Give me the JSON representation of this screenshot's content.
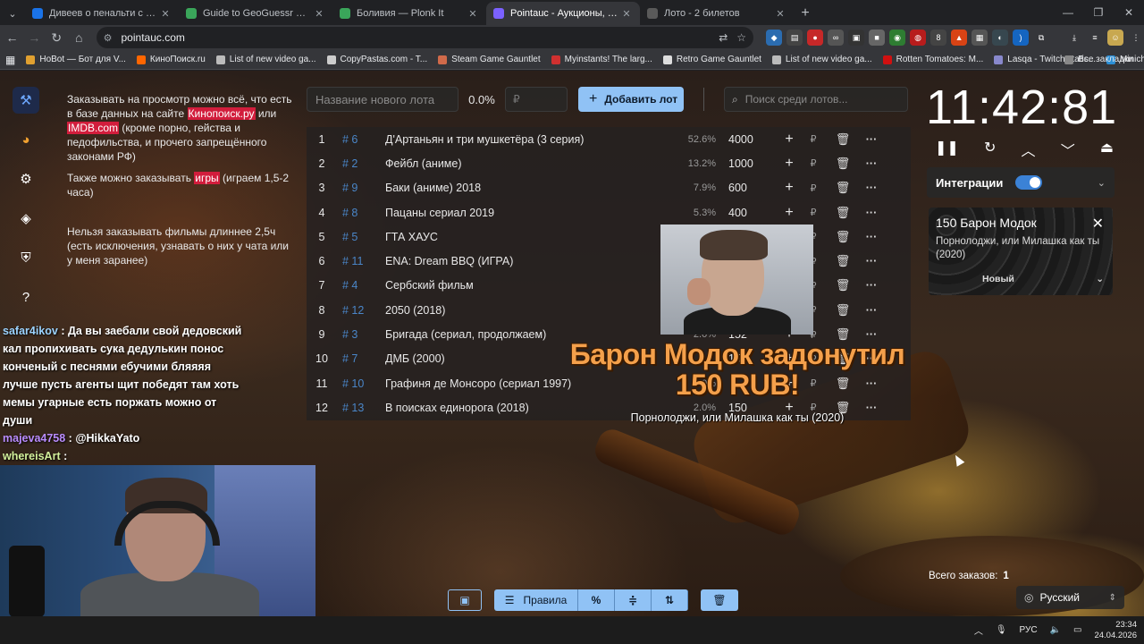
{
  "browser": {
    "tabs": [
      {
        "title": "Дивеев о пенальти с «Локо»:",
        "color": "#1a73e8",
        "active": false
      },
      {
        "title": "Guide to GeoGuessr — Plonk It",
        "color": "#3aa55a",
        "active": false
      },
      {
        "title": "Боливия — Plonk It",
        "color": "#3aa55a",
        "active": false
      },
      {
        "title": "Pointauc - Аукционы, лотереи",
        "color": "#7b61ff",
        "active": true
      },
      {
        "title": "Лото - 2 билетов",
        "color": "#5a5a5a",
        "active": false
      }
    ],
    "url": "pointauc.com",
    "bookmarks": [
      {
        "label": "HoBot — Бот для V...",
        "color": "#e0a030"
      },
      {
        "label": "КиноПоиск.ru",
        "color": "#ff6600"
      },
      {
        "label": "List of new video ga...",
        "color": "#bbbbbb"
      },
      {
        "label": "CopyPastas.com - T...",
        "color": "#cccccc"
      },
      {
        "label": "Steam Game Gauntlet",
        "color": "#d06a4a"
      },
      {
        "label": "Myinstants! The larg...",
        "color": "#d03030"
      },
      {
        "label": "Retro Game Gauntlet",
        "color": "#dddddd"
      },
      {
        "label": "List of new video ga...",
        "color": "#bbbbbb"
      },
      {
        "label": "Rotten Tomatoes: M...",
        "color": "#d01010"
      },
      {
        "label": "Lasqa - Twitch statis...",
        "color": "#8888cc"
      },
      {
        "label": "Minichat - The Fast...",
        "color": "#2b8fd6"
      }
    ],
    "all_bookmarks": "Все закладки"
  },
  "rules": {
    "p1_prefix": "Заказывать на просмотр можно всё, что есть в базе данных на сайте ",
    "p1_link1": "Кинопоиск.ру",
    "p1_mid": " или ",
    "p1_link2": "IMDB.com",
    "p1_suffix": " (кроме порно, гейства и педофильства, и прочего запрещённого законами РФ)",
    "p2_prefix": "Также можно заказывать ",
    "p2_link": "игры",
    "p2_suffix": " (играем 1,5-2 часа)",
    "p3": "Нельзя заказывать фильмы длиннее 2,5ч (есть исключения, узнавать о них у чата или у меня заранее)"
  },
  "lot_form": {
    "name_placeholder": "Название нового лота",
    "percent": "0.0%",
    "rub_placeholder": "₽",
    "add_label": "Добавить лот",
    "search_placeholder": "Поиск среди лотов..."
  },
  "lots": [
    {
      "n": "1",
      "id": "# 6",
      "name": "Д'Артаньян и три мушкетёра (3 серия)",
      "pct": "52.6%",
      "amount": "4000"
    },
    {
      "n": "2",
      "id": "# 2",
      "name": "Фейбл (аниме)",
      "pct": "13.2%",
      "amount": "1000"
    },
    {
      "n": "3",
      "id": "# 9",
      "name": "Баки (аниме) 2018",
      "pct": "7.9%",
      "amount": "600"
    },
    {
      "n": "4",
      "id": "# 8",
      "name": "Пацаны сериал 2019",
      "pct": "5.3%",
      "amount": "400"
    },
    {
      "n": "5",
      "id": "# 5",
      "name": "ГТА ХАУС",
      "pct": "",
      "amount": ""
    },
    {
      "n": "6",
      "id": "# 11",
      "name": "ENA: Dream BBQ (ИГРА)",
      "pct": "",
      "amount": ""
    },
    {
      "n": "7",
      "id": "# 4",
      "name": "Сербский фильм",
      "pct": "",
      "amount": ""
    },
    {
      "n": "8",
      "id": "# 12",
      "name": "2050 (2018)",
      "pct": "",
      "amount": ""
    },
    {
      "n": "9",
      "id": "# 3",
      "name": "Бригада (сериал, продолжаем)",
      "pct": "2.0%",
      "amount": "152"
    },
    {
      "n": "10",
      "id": "# 7",
      "name": "ДМБ (2000)",
      "pct": "",
      "amount": "150"
    },
    {
      "n": "11",
      "id": "# 10",
      "name": "Графиня де Монсоро (сериал 1997)",
      "pct": "2.0%",
      "amount": ""
    },
    {
      "n": "12",
      "id": "# 13",
      "name": "В поисках единорога (2018)",
      "pct": "2.0%",
      "amount": "150"
    }
  ],
  "lot_currency": "₽",
  "timer": {
    "value": "11:42:81"
  },
  "integrations": {
    "label": "Интеграции"
  },
  "donation_card": {
    "title": "150 Барон Модок",
    "text": "Порнолоджи, или Милашка как ты (2020)",
    "status": "Новый"
  },
  "donation_alert": {
    "headline": "Барон Модок задонутил 150 RUB!",
    "subtitle": "Порнолоджи, или Милашка как ты (2020)"
  },
  "chat": [
    {
      "user": "safar4ikov",
      "sep": " : ",
      "msg": "Да вы заебали свой дедовский кал пропихивать сука дедулькин понос конченый с песнями ебучими бляяяя лучше пусть агенты щит победят там хоть мемы угарные есть поржать можно от души"
    },
    {
      "user": "majeva4758",
      "sep": " : ",
      "msg": "@HikkaYato"
    },
    {
      "user": "whereisArt",
      "sep": " : ",
      "msg": ""
    }
  ],
  "bottom": {
    "rules_label": "Правила",
    "percent_symbol": "%"
  },
  "orders": {
    "label": "Всего заказов:",
    "count": "1"
  },
  "language": {
    "label": "Русский"
  },
  "taskbar": {
    "lang": "РУС",
    "time": "23:34",
    "date": "24.04.2026"
  }
}
